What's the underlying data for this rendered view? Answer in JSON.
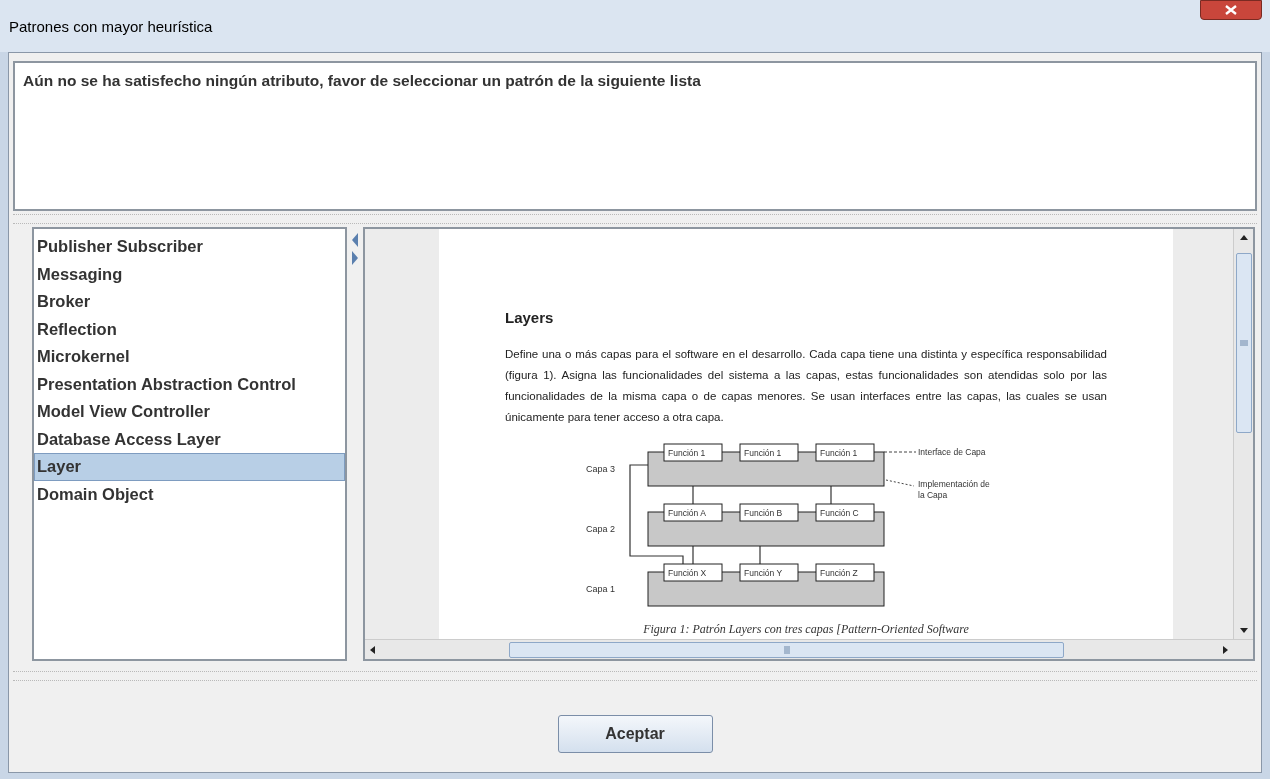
{
  "window": {
    "title": "Patrones con mayor heurística"
  },
  "message": "Aún no se ha satisfecho ningún atributo, favor de seleccionar un patrón de la siguiente lista",
  "patterns": [
    {
      "label": "Publisher Subscriber",
      "selected": false
    },
    {
      "label": "Messaging",
      "selected": false
    },
    {
      "label": "Broker",
      "selected": false
    },
    {
      "label": "Reflection",
      "selected": false
    },
    {
      "label": "Microkernel",
      "selected": false
    },
    {
      "label": "Presentation Abstraction Control",
      "selected": false
    },
    {
      "label": "Model View Controller",
      "selected": false
    },
    {
      "label": "Database Access Layer",
      "selected": false
    },
    {
      "label": "Layer",
      "selected": true
    },
    {
      "label": "Domain Object",
      "selected": false
    }
  ],
  "document": {
    "heading": "Layers",
    "paragraph": "Define una o más capas para el software en el desarrollo. Cada capa tiene una distinta y específica responsabilidad (figura 1). Asigna las funcionalidades del sistema a las capas, estas funcionalidades son atendidas solo por las funcionalidades de la misma capa o de capas menores. Se usan interfaces entre las capas, las cuales se usan únicamente para tener acceso a otra capa.",
    "figure": {
      "layers": [
        {
          "label": "Capa 3",
          "functions": [
            "Función 1",
            "Función 1",
            "Función 1"
          ]
        },
        {
          "label": "Capa 2",
          "functions": [
            "Función A",
            "Función B",
            "Función C"
          ]
        },
        {
          "label": "Capa 1",
          "functions": [
            "Función X",
            "Función Y",
            "Función Z"
          ]
        }
      ],
      "interface_note": "Interface de Capa",
      "implementation_note": [
        "Implementación de",
        "la Capa"
      ]
    },
    "caption": "Figura 1: Patrón Layers con tres capas [Pattern-Oriented Software"
  },
  "buttons": [
    "Aceptar"
  ]
}
